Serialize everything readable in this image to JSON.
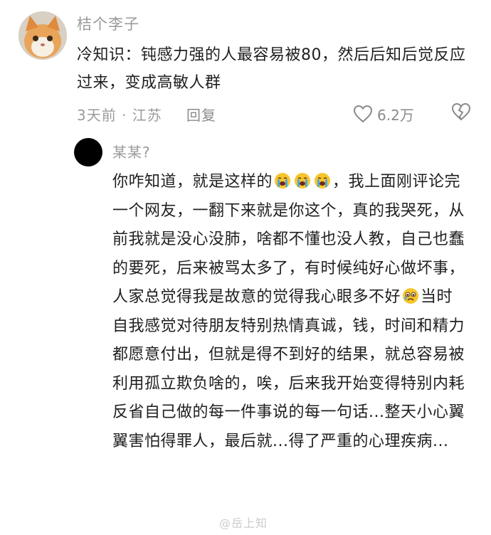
{
  "main_comment": {
    "author": "桔个李子",
    "text": "冷知识：钝感力强的人最容易被80，然后后知后觉反应过来，变成高敏人群",
    "time_location": "3天前 · 江苏",
    "reply_label": "回复",
    "like_count": "6.2万"
  },
  "reply": {
    "author": "某某?",
    "text_part1": "你咋知道，就是这样的",
    "text_part2": "，我上面刚评论完一个网友，一翻下来就是你这个，真的我哭死，从前我就是没心没肺，啥都不懂也没人教，自己也蠢的要死，后来被骂太多了，有时候纯好心做坏事，人家总觉得我是故意的觉得我心眼多不好",
    "text_part3": "当时自我感觉对待朋友特别热情真诚，钱，时间和精力都愿意付出，但就是得不到好的结果，就总容易被利用孤立欺负啥的，唉，后来我开始变得特别内耗反省自己做的每一件事说的每一句话...整天小心翼翼害怕得罪人，最后就...得了严重的心理疾病..."
  },
  "icons": {
    "like": "heart-outline-icon",
    "dislike": "broken-heart-outline-icon",
    "crying": "loudly-crying-face-emoji",
    "weary": "tearful-face-emoji"
  },
  "watermark": "@岳上知"
}
